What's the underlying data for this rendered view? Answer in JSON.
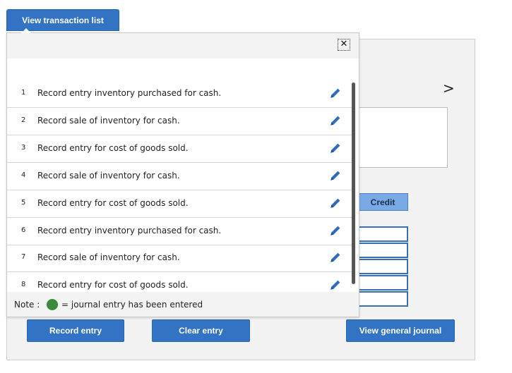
{
  "toolbar": {
    "view_list_label": "View transaction list"
  },
  "popup": {
    "close_glyph": "✕",
    "rows": [
      {
        "num": "1",
        "text": "Record entry inventory purchased for cash."
      },
      {
        "num": "2",
        "text": "Record sale of inventory for cash."
      },
      {
        "num": "3",
        "text": "Record entry for cost of goods sold."
      },
      {
        "num": "4",
        "text": "Record sale of inventory for cash."
      },
      {
        "num": "5",
        "text": "Record entry for cost of goods sold."
      },
      {
        "num": "6",
        "text": "Record entry inventory purchased for cash."
      },
      {
        "num": "7",
        "text": "Record sale of inventory for cash."
      },
      {
        "num": "8",
        "text": "Record entry for cost of goods sold."
      }
    ],
    "note": {
      "label": "Note :",
      "meaning": "= journal entry has been entered",
      "dot_color": "#3a8a3a"
    }
  },
  "panel": {
    "next_glyph": ">",
    "credit_header": "Credit"
  },
  "actions": {
    "record_label": "Record entry",
    "clear_label": "Clear entry",
    "journal_label": "View general journal"
  },
  "colors": {
    "accent": "#3373c4",
    "pencil": "#2f6db8",
    "credit_header_bg": "#7aaae5"
  },
  "icons": {
    "edit": "pencil-icon",
    "close": "close-icon",
    "next": "chevron-right-icon"
  }
}
